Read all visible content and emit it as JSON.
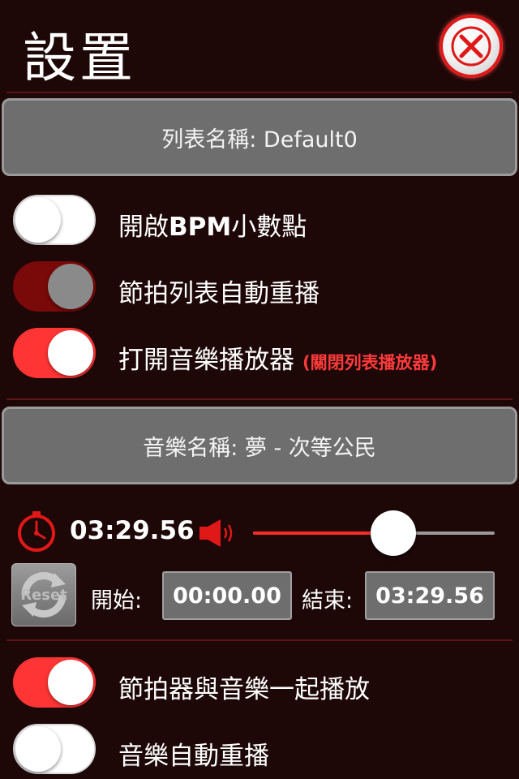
{
  "header": {
    "title": "設置"
  },
  "playlist": {
    "name_label": "列表名稱: Default0"
  },
  "settings": {
    "bpm_decimal": {
      "label_prefix": "開啟",
      "label_bold": "BPM",
      "label_suffix": "小數點",
      "on": false
    },
    "list_autoreplay": {
      "label": "節拍列表自動重播",
      "on": true,
      "enabled": false
    },
    "music_player": {
      "label": "打開音樂播放器",
      "note": "(關閉列表播放器)",
      "on": true
    }
  },
  "music": {
    "name_label": "音樂名稱: 夢 - 次等公民",
    "current_time": "03:29.56",
    "volume_level": 0.58,
    "reset_label": "Reset",
    "start_label": "開始:",
    "start_value": "00:00.00",
    "end_label": "結束:",
    "end_value": "03:29.56"
  },
  "bottom": {
    "play_with_music": {
      "label": "節拍器與音樂一起播放",
      "on": true
    },
    "music_autoreplay": {
      "label": "音樂自動重播",
      "on": false
    }
  },
  "colors": {
    "background": "#1d0707",
    "accent": "#ff3434",
    "box_gray": "#6e6e6e"
  },
  "icons": {
    "close": "close-icon",
    "clock": "clock-icon",
    "speaker": "speaker-icon",
    "reset": "reset-icon"
  }
}
